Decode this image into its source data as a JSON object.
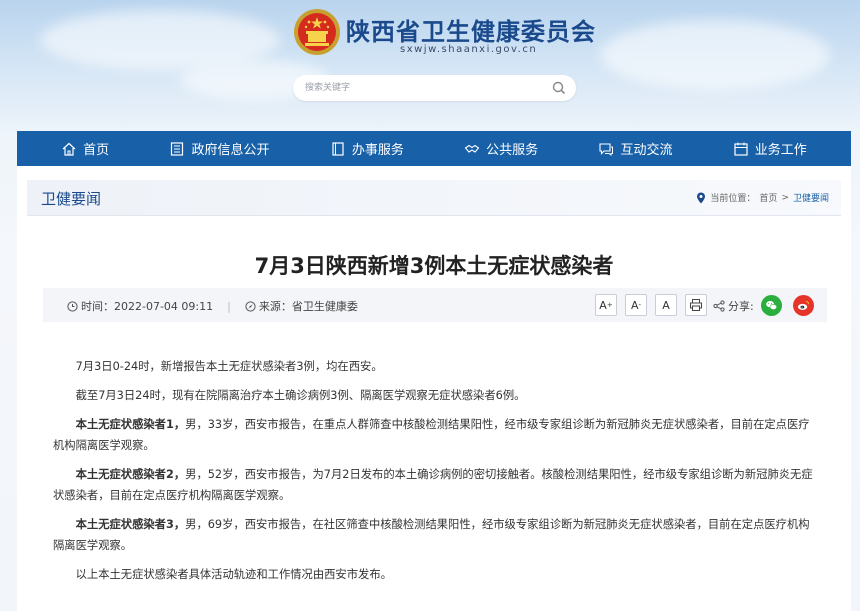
{
  "header": {
    "site_title": "陕西省卫生健康委员会",
    "site_domain": "sxwjw.shaanxi.gov.cn",
    "search_placeholder": "搜索关键字"
  },
  "nav": {
    "items": [
      {
        "label": "首页",
        "icon": "home-icon"
      },
      {
        "label": "政府信息公开",
        "icon": "document-list-icon"
      },
      {
        "label": "办事服务",
        "icon": "form-icon"
      },
      {
        "label": "公共服务",
        "icon": "handshake-icon"
      },
      {
        "label": "互动交流",
        "icon": "chat-icon"
      },
      {
        "label": "业务工作",
        "icon": "calendar-icon"
      }
    ]
  },
  "section": {
    "title": "卫健要闻",
    "breadcrumb_prefix": "当前位置：",
    "breadcrumb_home": "首页",
    "breadcrumb_sep": ">",
    "breadcrumb_current": "卫健要闻"
  },
  "article": {
    "title": "7月3日陕西新增3例本土无症状感染者",
    "time_label": "时间：2022-07-04 09:11",
    "source_label": "来源：省卫生健康委",
    "font_large": "A",
    "font_medium": "A",
    "font_small": "A",
    "share_label": "分享:",
    "paragraphs": {
      "p1": "7月3日0-24时，新增报告本土无症状感染者3例，均在西安。",
      "p2": "截至7月3日24时，现有在院隔离治疗本土确诊病例3例、隔离医学观察无症状感染者6例。",
      "p3_bold": "本土无症状感染者1，",
      "p3_text": "男，33岁，西安市报告，在重点人群筛查中核酸检测结果阳性，经市级专家组诊断为新冠肺炎无症状感染者，目前在定点医疗机构隔离医学观察。",
      "p4_bold": "本土无症状感染者2，",
      "p4_text": "男，52岁，西安市报告，为7月2日发布的本土确诊病例的密切接触者。核酸检测结果阳性，经市级专家组诊断为新冠肺炎无症状感染者，目前在定点医疗机构隔离医学观察。",
      "p5_bold": "本土无症状感染者3，",
      "p5_text": "男，69岁，西安市报告，在社区筛查中核酸检测结果阳性，经市级专家组诊断为新冠肺炎无症状感染者，目前在定点医疗机构隔离医学观察。",
      "p6": "以上本土无症状感染者具体活动轨迹和工作情况由西安市发布。"
    }
  },
  "colors": {
    "nav_bg": "#1860a8",
    "title_blue": "#1a4a8c",
    "wechat": "#2aae3e",
    "weibo": "#e6342a"
  }
}
